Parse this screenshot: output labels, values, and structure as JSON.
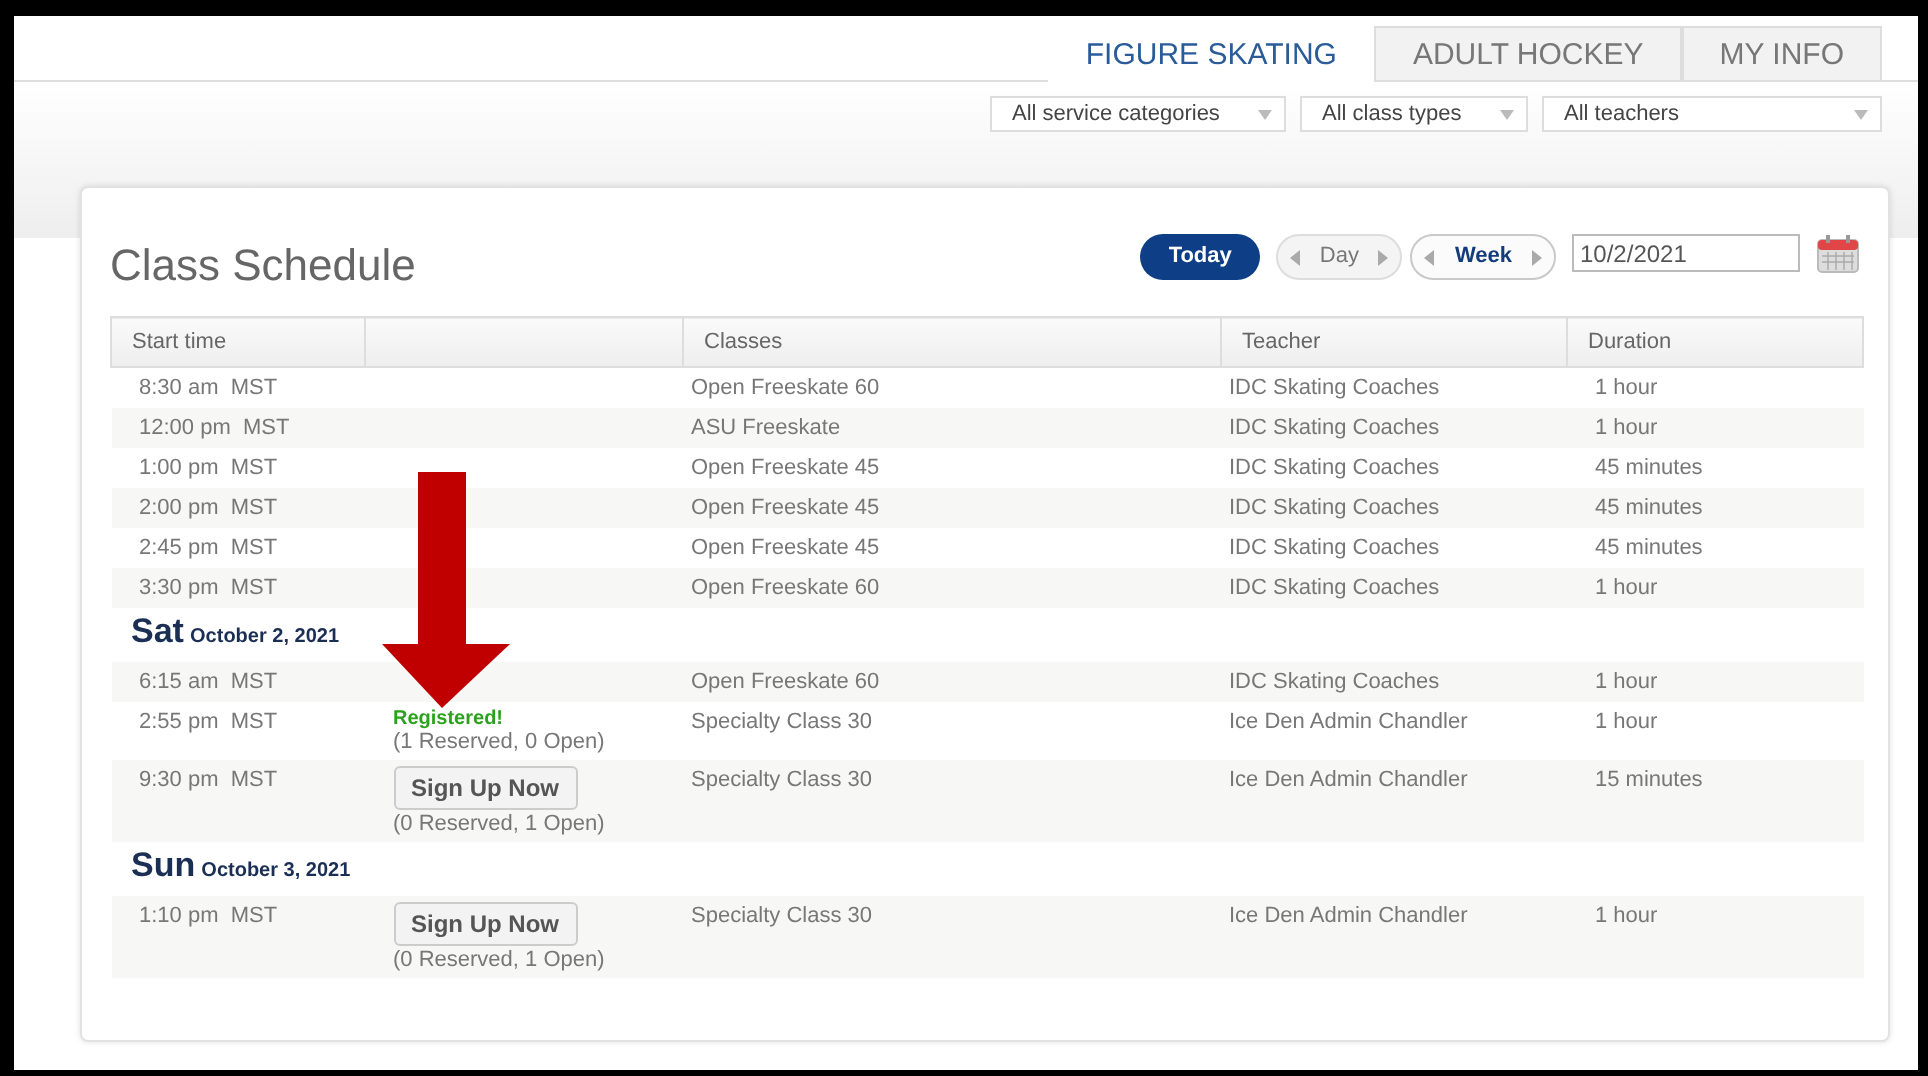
{
  "tabs": [
    {
      "label": "FIGURE SKATING",
      "selected": true
    },
    {
      "label": "ADULT HOCKEY",
      "selected": false
    },
    {
      "label": "MY INFO",
      "selected": false
    }
  ],
  "filters": [
    {
      "value": "All service categories"
    },
    {
      "value": "All class types"
    },
    {
      "value": "All teachers"
    }
  ],
  "schedule": {
    "title": "Class Schedule",
    "nav": [
      {
        "label": "Today",
        "kind": "primary"
      },
      {
        "label": "Day",
        "kind": "pager",
        "selected": false
      },
      {
        "label": "Week",
        "kind": "pager",
        "selected": true
      }
    ],
    "date_field": {
      "value": "10/2/2021"
    },
    "table": {
      "columns": [
        "Start time",
        "",
        "Classes",
        "Teacher",
        "Duration"
      ],
      "rows": [
        {
          "kind": "session",
          "time": "8:30 am  MST",
          "classes": "Open Freeskate 60",
          "teacher": "IDC Skating Coaches",
          "duration": "1 hour"
        },
        {
          "kind": "session",
          "time": "12:00 pm  MST",
          "classes": "ASU Freeskate",
          "teacher": "IDC Skating Coaches",
          "duration": "1 hour"
        },
        {
          "kind": "session",
          "time": "1:00 pm  MST",
          "classes": "Open Freeskate 45",
          "teacher": "IDC Skating Coaches",
          "duration": "45 minutes"
        },
        {
          "kind": "session",
          "time": "2:00 pm  MST",
          "classes": "Open Freeskate 45",
          "teacher": "IDC Skating Coaches",
          "duration": "45 minutes"
        },
        {
          "kind": "session",
          "time": "2:45 pm  MST",
          "classes": "Open Freeskate 45",
          "teacher": "IDC Skating Coaches",
          "duration": "45 minutes"
        },
        {
          "kind": "session",
          "time": "3:30 pm  MST",
          "classes": "Open Freeskate 60",
          "teacher": "IDC Skating Coaches",
          "duration": "1 hour"
        },
        {
          "kind": "day",
          "day": "Sat",
          "date": "October 2, 2021"
        },
        {
          "kind": "session",
          "time": "6:15 am  MST",
          "classes": "Open Freeskate 60",
          "teacher": "IDC Skating Coaches",
          "duration": "1 hour"
        },
        {
          "kind": "session",
          "time": "2:55 pm  MST",
          "status": {
            "kind": "registered",
            "label": "Registered!"
          },
          "availability": "(1 Reserved, 0 Open)",
          "classes": "Specialty Class 30",
          "teacher": "Ice Den Admin Chandler",
          "duration": "1 hour"
        },
        {
          "kind": "session",
          "time": "9:30 pm  MST",
          "status": {
            "kind": "button",
            "label": "Sign Up Now"
          },
          "availability": "(0 Reserved, 1 Open)",
          "classes": "Specialty Class 30",
          "teacher": "Ice Den Admin Chandler",
          "duration": "15 minutes"
        },
        {
          "kind": "day",
          "day": "Sun",
          "date": "October 3, 2021"
        },
        {
          "kind": "session",
          "time": "1:10 pm  MST",
          "status": {
            "kind": "button",
            "label": "Sign Up Now"
          },
          "availability": "(0 Reserved, 1 Open)",
          "classes": "Specialty Class 30",
          "teacher": "Ice Den Admin Chandler",
          "duration": "1 hour"
        }
      ]
    }
  }
}
